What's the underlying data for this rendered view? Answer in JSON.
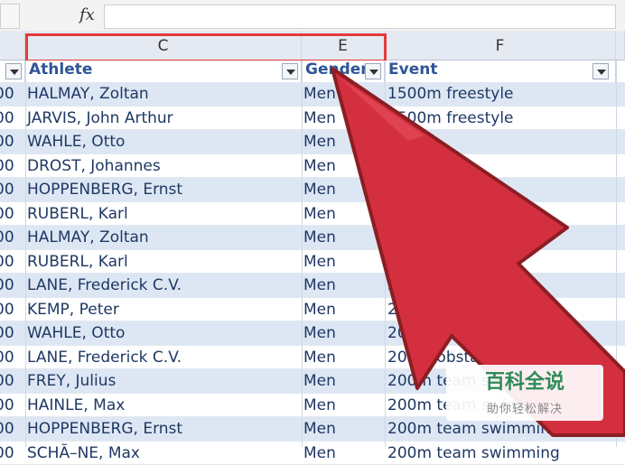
{
  "formula_bar": {
    "fx_label": "fx",
    "value": ""
  },
  "columns": {
    "c": "C",
    "e": "E",
    "f": "F"
  },
  "headers": {
    "col_a": "",
    "athlete": "Athlete",
    "gender": "Gender",
    "event": "Event"
  },
  "rows": [
    {
      "a": "00",
      "athlete": "HALMAY, Zoltan",
      "gender": "Men",
      "event": "1500m freestyle"
    },
    {
      "a": "00",
      "athlete": "JARVIS, John Arthur",
      "gender": "Men",
      "event": "1500m freestyle"
    },
    {
      "a": "00",
      "athlete": "WAHLE, Otto",
      "gender": "Men",
      "event": ""
    },
    {
      "a": "00",
      "athlete": "DROST, Johannes",
      "gender": "Men",
      "event": ""
    },
    {
      "a": "00",
      "athlete": "HOPPENBERG, Ernst",
      "gender": "Men",
      "event": ""
    },
    {
      "a": "00",
      "athlete": "RUBERL, Karl",
      "gender": "Men",
      "event": ""
    },
    {
      "a": "00",
      "athlete": "HALMAY, Zoltan",
      "gender": "Men",
      "event": "200"
    },
    {
      "a": "00",
      "athlete": "RUBERL, Karl",
      "gender": "Men",
      "event": "200m freestyle"
    },
    {
      "a": "00",
      "athlete": "LANE, Frederick C.V.",
      "gender": "Men",
      "event": "200m freestyle"
    },
    {
      "a": "00",
      "athlete": "KEMP, Peter",
      "gender": "Men",
      "event": "200m obstacle event"
    },
    {
      "a": "00",
      "athlete": "WAHLE, Otto",
      "gender": "Men",
      "event": "200m obstacle event"
    },
    {
      "a": "00",
      "athlete": "LANE, Frederick C.V.",
      "gender": "Men",
      "event": "200m obstacle event"
    },
    {
      "a": "00",
      "athlete": "FREY, Julius",
      "gender": "Men",
      "event": "200m team swimming"
    },
    {
      "a": "00",
      "athlete": "HAINLE, Max",
      "gender": "Men",
      "event": "200m team swimming"
    },
    {
      "a": "00",
      "athlete": "HOPPENBERG, Ernst",
      "gender": "Men",
      "event": "200m team swimming"
    },
    {
      "a": "00",
      "athlete": "SCHÃ–NE, Max",
      "gender": "Men",
      "event": "200m team swimming"
    }
  ],
  "watermark": {
    "title": "百科全说",
    "subtitle": "助你轻松解决"
  },
  "colors": {
    "highlight": "#e23b3b",
    "arrow": "#d32f3f",
    "header_text": "#2f5597",
    "row_band": "#dde7f3"
  }
}
